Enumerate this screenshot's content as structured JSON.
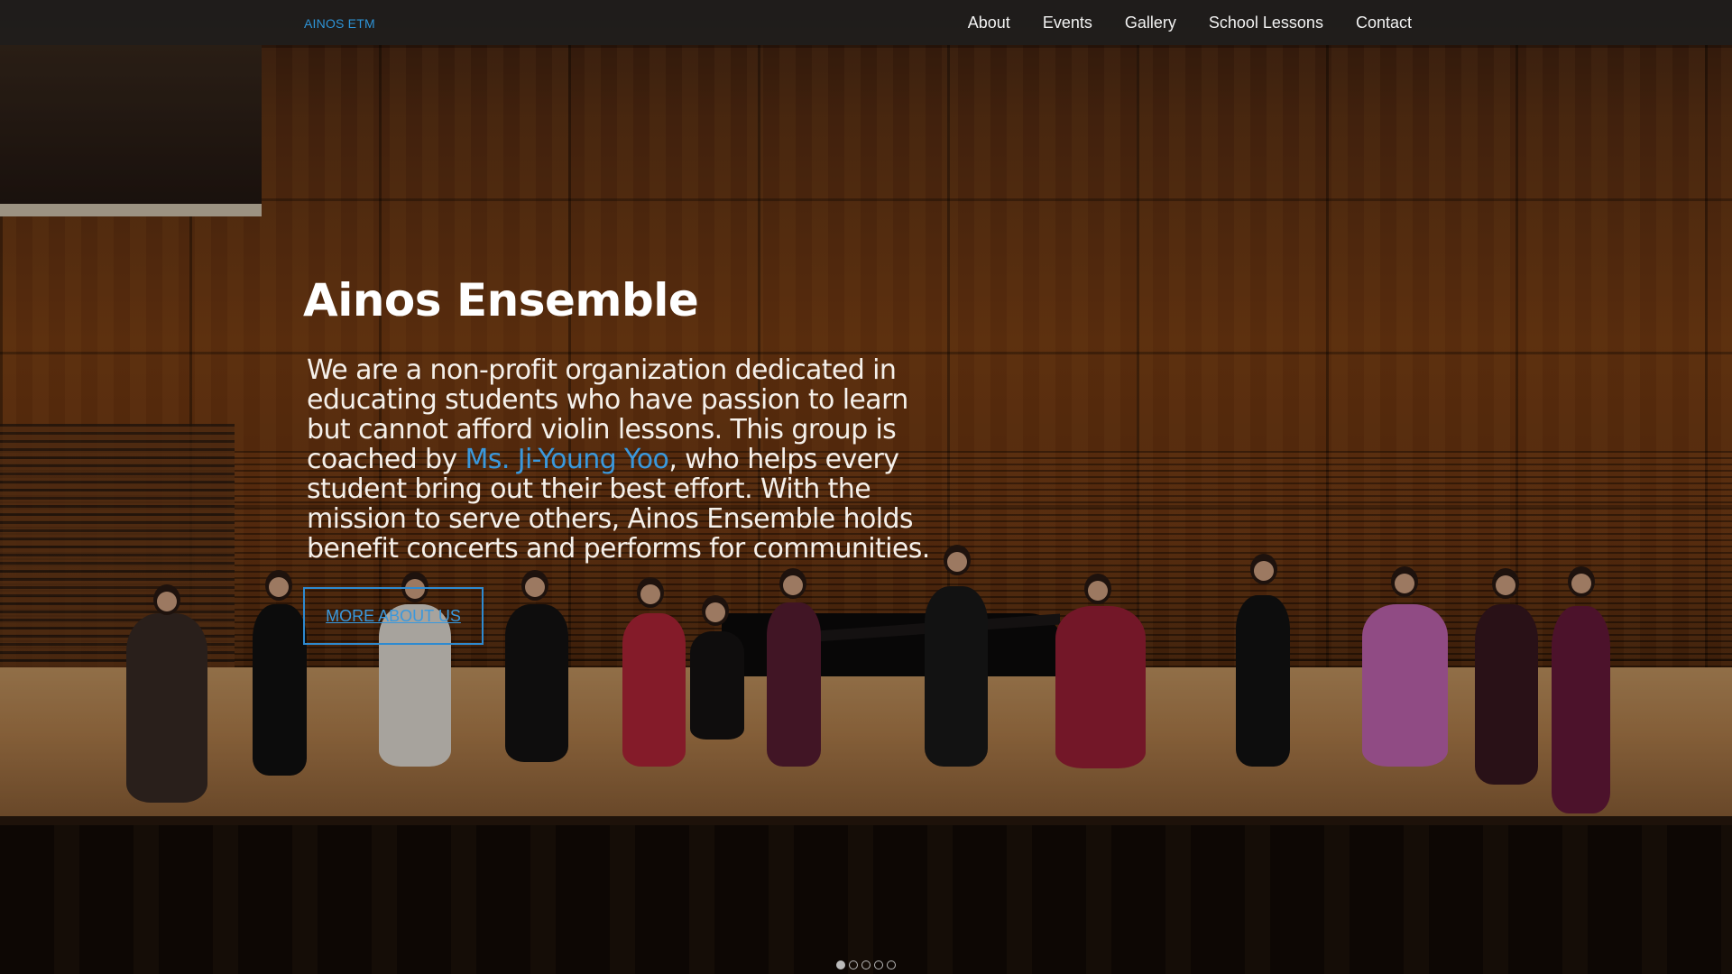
{
  "nav": {
    "brand": "AINOS ETM",
    "links": [
      "About",
      "Events",
      "Gallery",
      "School Lessons",
      "Contact"
    ]
  },
  "hero": {
    "title": "Ainos Ensemble",
    "text_before": "We are a non-profit organization dedicated in educating students who have passion to learn but cannot afford violin lessons. This group is coached by ",
    "coach_link": "Ms. Ji-Young Yoo",
    "text_after": ", who helps every student bring out their best effort. With the mission to serve others, Ainos Ensemble holds benefit concerts and performs for communities.",
    "cta_label": "MORE ABOUT US"
  },
  "carousel": {
    "slide_count": 5,
    "active_index": 0
  },
  "colors": {
    "accent": "#2e93d6",
    "navbar": "#1e1e1e",
    "text": "#ffffff"
  }
}
